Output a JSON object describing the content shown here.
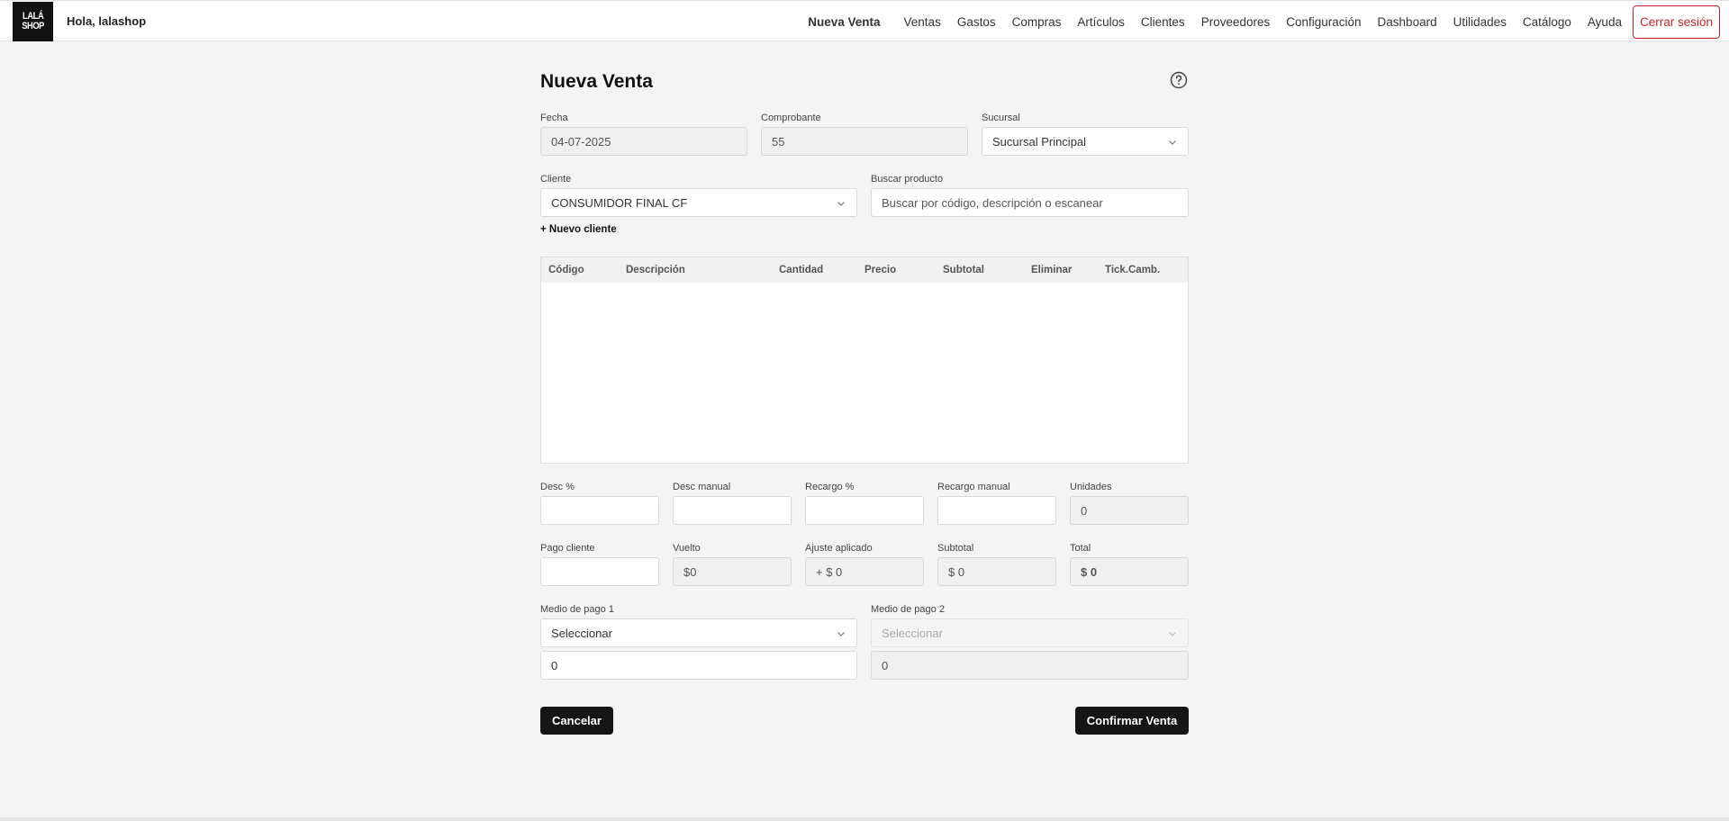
{
  "header": {
    "logo_line1": "LALÁ",
    "logo_line2": "SHOP",
    "greeting": "Hola, lalashop",
    "nav": [
      "Nueva Venta",
      "Ventas",
      "Gastos",
      "Compras",
      "Artículos",
      "Clientes",
      "Proveedores",
      "Configuración",
      "Dashboard",
      "Utilidades",
      "Catálogo",
      "Ayuda"
    ],
    "logout_label": "Cerrar sesión"
  },
  "page": {
    "title": "Nueva Venta"
  },
  "form": {
    "fecha": {
      "label": "Fecha",
      "value": "04-07-2025"
    },
    "comprobante": {
      "label": "Comprobante",
      "value": "55"
    },
    "sucursal": {
      "label": "Sucursal",
      "value": "Sucursal Principal"
    },
    "cliente": {
      "label": "Cliente",
      "value": "CONSUMIDOR FINAL CF"
    },
    "buscar": {
      "label": "Buscar producto",
      "placeholder": "Buscar por código, descripción o escanear"
    },
    "new_client_label": "+ Nuevo cliente"
  },
  "table": {
    "columns": [
      "Código",
      "Descripción",
      "Cantidad",
      "Precio",
      "Subtotal",
      "Eliminar",
      "Tick.Camb."
    ],
    "rows": []
  },
  "adjustments": {
    "desc_pct": {
      "label": "Desc %",
      "value": ""
    },
    "desc_manual": {
      "label": "Desc manual",
      "value": ""
    },
    "recargo_pct": {
      "label": "Recargo %",
      "value": ""
    },
    "recargo_manual": {
      "label": "Recargo manual",
      "value": ""
    },
    "unidades": {
      "label": "Unidades",
      "value": "0"
    }
  },
  "totals": {
    "pago_cliente": {
      "label": "Pago cliente",
      "value": ""
    },
    "vuelto": {
      "label": "Vuelto",
      "value": "$0"
    },
    "ajuste": {
      "label": "Ajuste aplicado",
      "value": "+ $ 0"
    },
    "subtotal": {
      "label": "Subtotal",
      "value": "$ 0"
    },
    "total": {
      "label": "Total",
      "value": "$ 0"
    }
  },
  "payment": {
    "medio1": {
      "label": "Medio de pago 1",
      "value": "Seleccionar",
      "amount": "0"
    },
    "medio2": {
      "label": "Medio de pago 2",
      "value": "Seleccionar",
      "amount": "0"
    }
  },
  "actions": {
    "cancel_label": "Cancelar",
    "confirm_label": "Confirmar Venta"
  }
}
